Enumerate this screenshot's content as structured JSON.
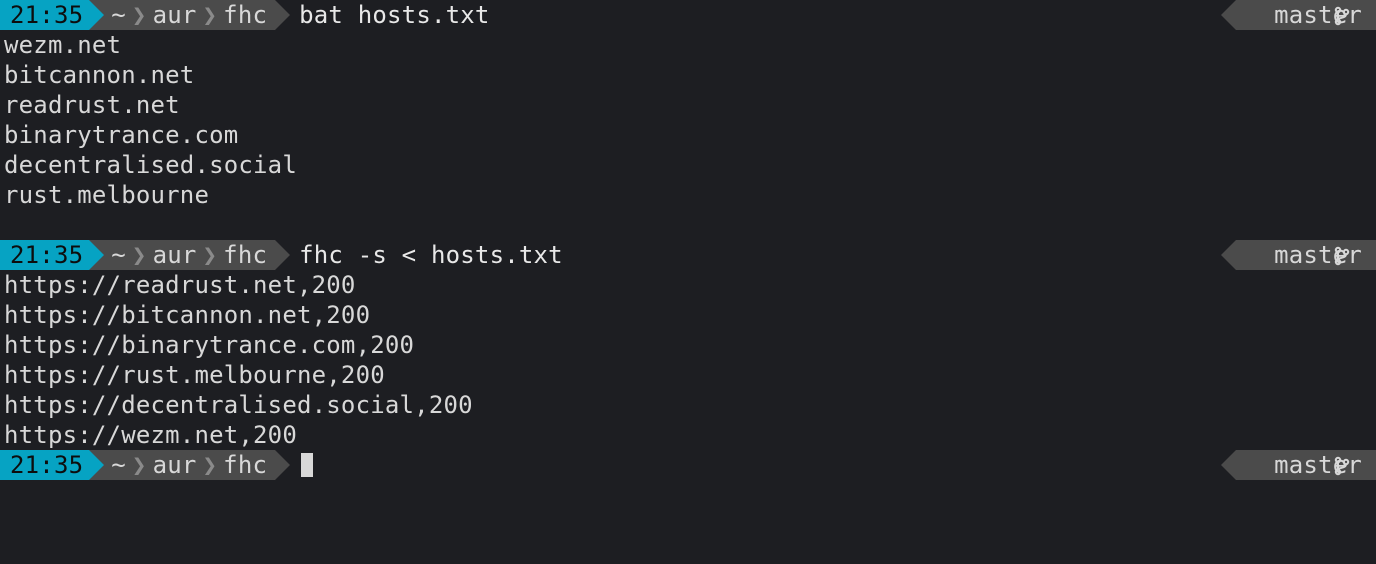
{
  "prompts": [
    {
      "time": "21:35",
      "path_segments": [
        "~",
        "aur",
        "fhc"
      ],
      "command": "bat hosts.txt",
      "branch": "master",
      "output": [
        "wezm.net",
        "bitcannon.net",
        "readrust.net",
        "binarytrance.com",
        "decentralised.social",
        "rust.melbourne"
      ]
    },
    {
      "time": "21:35",
      "path_segments": [
        "~",
        "aur",
        "fhc"
      ],
      "command": "fhc -s < hosts.txt",
      "branch": "master",
      "output": [
        "https://readrust.net,200",
        "https://bitcannon.net,200",
        "https://binarytrance.com,200",
        "https://rust.melbourne,200",
        "https://decentralised.social,200",
        "https://wezm.net,200"
      ]
    },
    {
      "time": "21:35",
      "path_segments": [
        "~",
        "aur",
        "fhc"
      ],
      "command": "",
      "branch": "master",
      "output": []
    }
  ],
  "path_separator": "❯"
}
